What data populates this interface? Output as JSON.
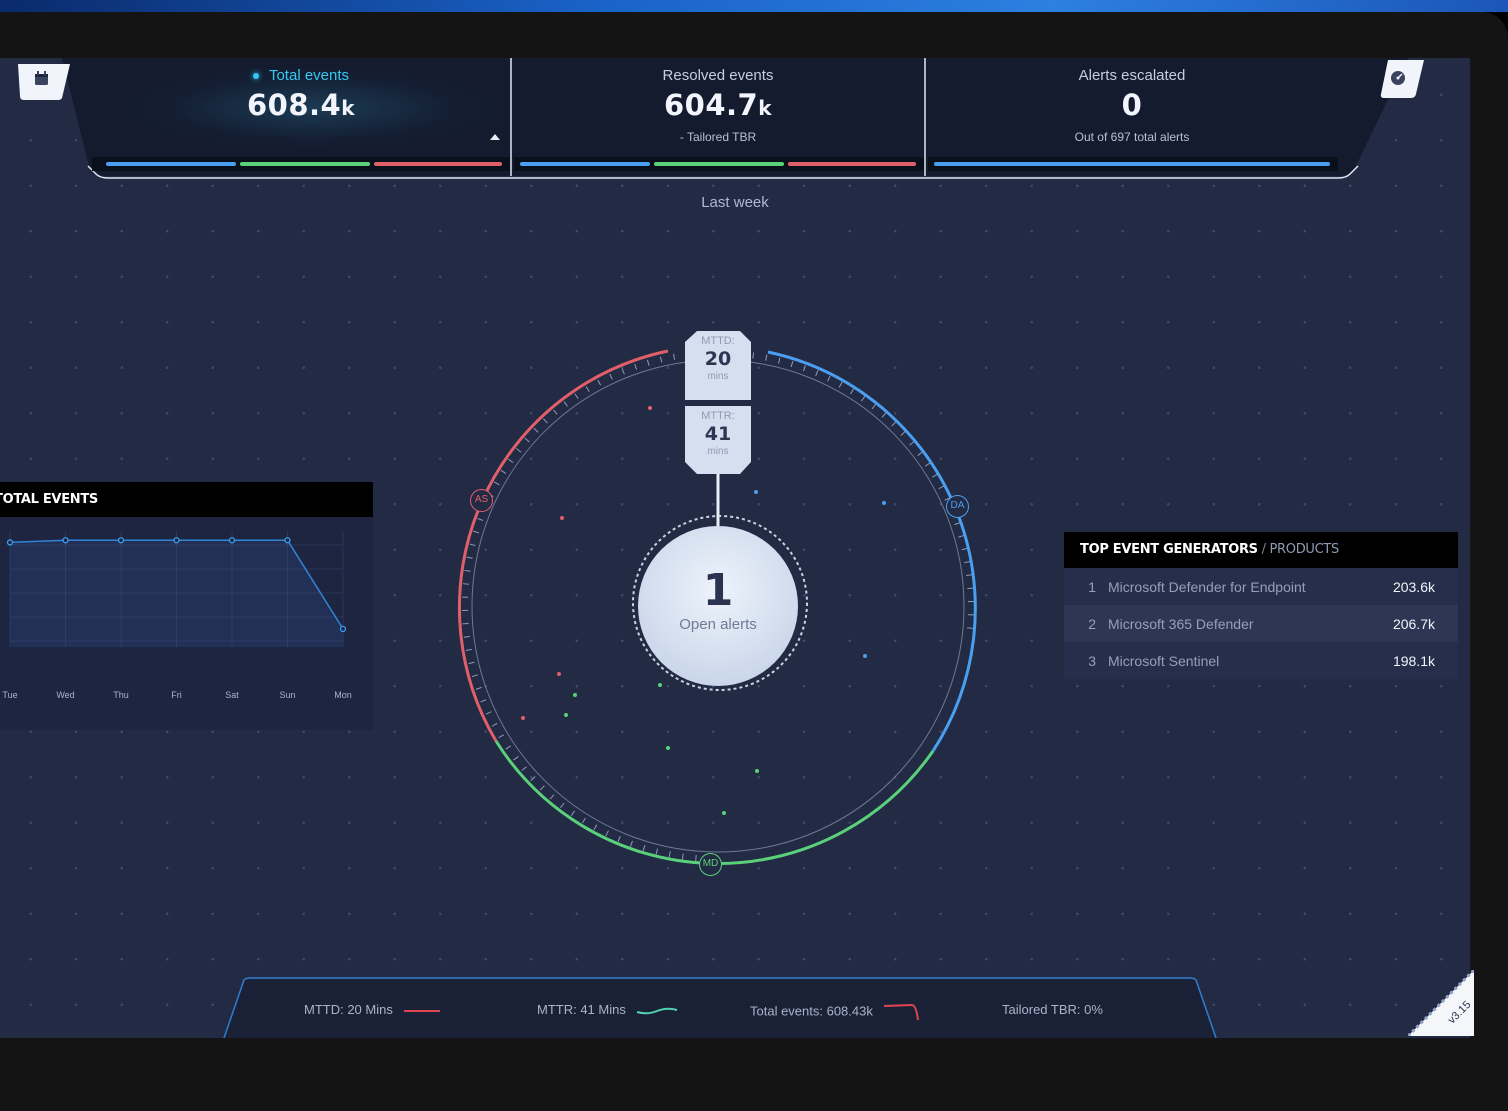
{
  "kpis": {
    "total": {
      "label": "Total events",
      "value": "608.4",
      "unit": "k"
    },
    "resolved": {
      "label": "Resolved events",
      "value": "604.7",
      "unit": "k",
      "sub": "- Tailored TBR"
    },
    "alerts": {
      "label": "Alerts escalated",
      "value": "0",
      "sub": "Out of 697 total alerts"
    }
  },
  "period": "Last week",
  "center": {
    "mttd": {
      "label": "MTTD:",
      "value": "20",
      "unit": "mins"
    },
    "mttr": {
      "label": "MTTR:",
      "value": "41",
      "unit": "mins"
    },
    "open_alerts": {
      "value": "1",
      "label": "Open alerts"
    },
    "markers": {
      "as": "AS",
      "da": "DA",
      "md": "MD"
    }
  },
  "total_events_panel": {
    "title": "TOTAL EVENTS",
    "chart_data": {
      "type": "line",
      "x": [
        "Tue",
        "Wed",
        "Thu",
        "Fri",
        "Sat",
        "Sun",
        "Mon"
      ],
      "series": [
        {
          "values": [
            0.98,
            1.0,
            1.0,
            1.0,
            1.0,
            1.0,
            0.17
          ]
        }
      ],
      "grid": true
    }
  },
  "generators": {
    "title_strong": "TOP EVENT GENERATORS",
    "title_sep": " / ",
    "title_weak": "PRODUCTS",
    "rows": [
      {
        "rank": "1",
        "name": "Microsoft Defender for Endpoint",
        "value": "203.6k"
      },
      {
        "rank": "2",
        "name": "Microsoft 365 Defender",
        "value": "206.7k"
      },
      {
        "rank": "3",
        "name": "Microsoft Sentinel",
        "value": "198.1k"
      }
    ]
  },
  "status_bar": {
    "mttd": "MTTD: 20 Mins",
    "mttr": "MTTR: 41 Mins",
    "total": "Total events: 608.43k",
    "tbr": "Tailored TBR: 0%"
  },
  "version": "v3.15",
  "colors": {
    "red": "#e0606a",
    "blue": "#4a9ff0",
    "green": "#5ad07a",
    "accent": "#35c9f2",
    "bg": "#222a44"
  }
}
